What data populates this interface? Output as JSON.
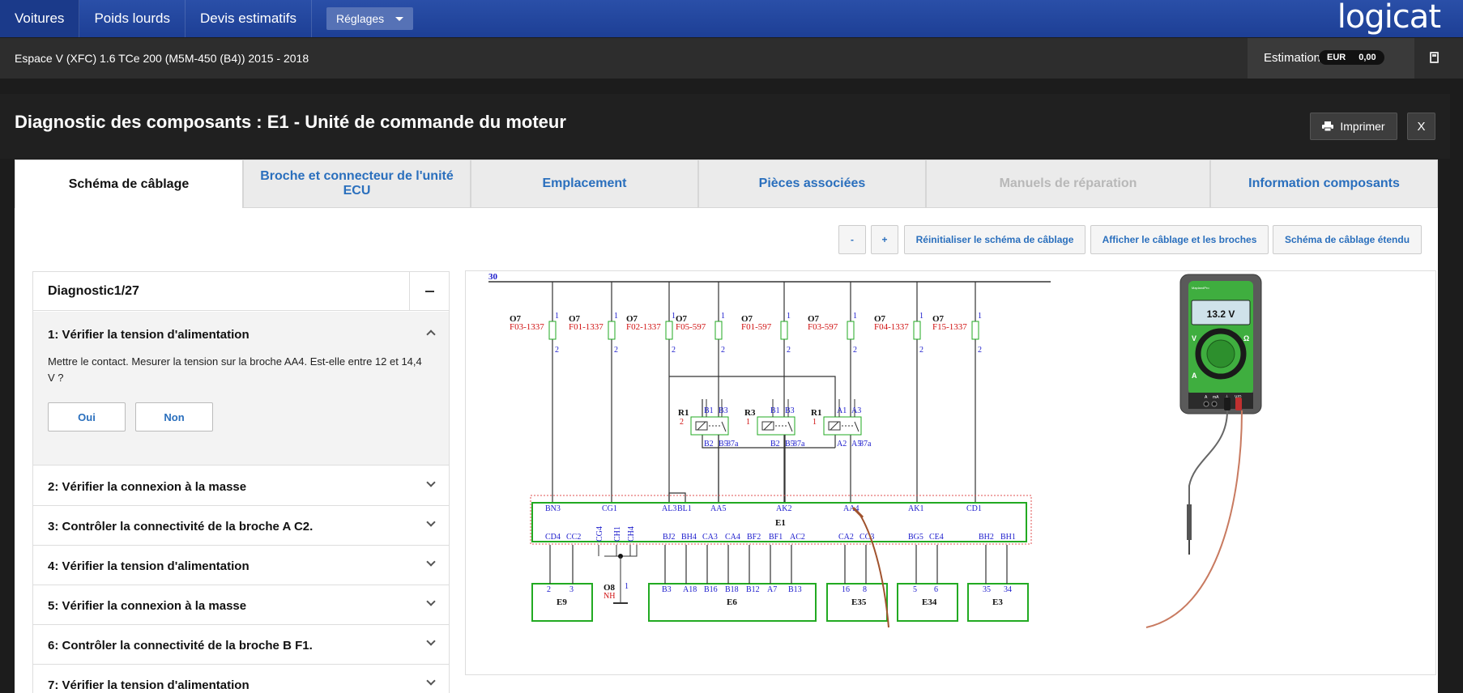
{
  "nav": {
    "items": [
      "Voitures",
      "Poids lourds",
      "Devis estimatifs"
    ],
    "settings": "Réglages",
    "logo": "logicat"
  },
  "vehicle": {
    "name": "Espace V (XFC) 1.6 TCe 200 (M5M-450 (B4)) 2015 - 2018",
    "estimation_label": "Estimation",
    "currency": "EUR",
    "amount": "0,00"
  },
  "modal": {
    "title": "Diagnostic des composants : E1 - Unité de commande du moteur",
    "print_label": "Imprimer",
    "close_label": "X"
  },
  "tabs": [
    {
      "label": "Schéma de câblage",
      "state": "active"
    },
    {
      "label": "Broche et connecteur de l'unité ECU",
      "state": "normal"
    },
    {
      "label": "Emplacement",
      "state": "normal"
    },
    {
      "label": "Pièces associées",
      "state": "normal"
    },
    {
      "label": "Manuels de réparation",
      "state": "disabled"
    },
    {
      "label": "Information composants",
      "state": "normal"
    }
  ],
  "toolbar": {
    "zoom_out": "-",
    "zoom_in": "+",
    "reset": "Réinitialiser le schéma de câblage",
    "show_pins": "Afficher le câblage et les broches",
    "extended": "Schéma de câblage étendu"
  },
  "diagnostic": {
    "title": "Diagnostic1/27",
    "open_step": {
      "title": "1: Vérifier la tension d'alimentation",
      "text": "Mettre le contact. Mesurer la tension sur la broche AA4. Est-elle entre 12 et 14,4 V ?",
      "yes": "Oui",
      "no": "Non"
    },
    "steps": [
      "2: Vérifier la connexion à la masse",
      "3: Contrôler la connectivité de la broche A C2.",
      "4: Vérifier la tension d'alimentation",
      "5: Vérifier la connexion à la masse",
      "6: Contrôler la connectivité de la broche B F1.",
      "7: Vérifier la tension d'alimentation"
    ]
  },
  "schema": {
    "bus_label": "30",
    "fuses": [
      {
        "code": "F03-1337"
      },
      {
        "code": "F01-1337"
      },
      {
        "code": "F02-1337"
      },
      {
        "code": "F05-597"
      },
      {
        "code": "F01-597"
      },
      {
        "code": "F03-597"
      },
      {
        "code": "F04-1337"
      },
      {
        "code": "F15-1337"
      }
    ],
    "fuse_group": "O7",
    "relays": [
      {
        "name": "R1",
        "num": "2",
        "top": [
          "B1",
          "B3"
        ],
        "bottom": [
          "B2",
          "B5",
          "87a"
        ]
      },
      {
        "name": "R3",
        "num": "1",
        "top": [
          "B1",
          "B3"
        ],
        "bottom": [
          "B2",
          "B5",
          "87a"
        ]
      },
      {
        "name": "R1",
        "num": "1",
        "top": [
          "A1",
          "A3"
        ],
        "bottom": [
          "A2",
          "A5",
          "87a"
        ]
      }
    ],
    "ecu_name": "E1",
    "ecu_top_pins": [
      "BN3",
      "CG1",
      "AL3",
      "BL1",
      "AA5",
      "AK2",
      "AA4",
      "AK1",
      "CD1"
    ],
    "ecu_bottom_pins": [
      "CD4",
      "CC2",
      "CG4",
      "CH1",
      "CH4",
      "BJ2",
      "BH4",
      "CA3",
      "CA4",
      "BF2",
      "BF1",
      "AC2",
      "CA2",
      "CC3",
      "BG5",
      "CE4",
      "BH2",
      "BH1"
    ],
    "connectors": [
      {
        "name": "E9",
        "pins": [
          "2",
          "3"
        ]
      },
      {
        "name": "E6",
        "pins": [
          "B3",
          "A18",
          "B16",
          "B18",
          "B12",
          "A7",
          "B13"
        ]
      },
      {
        "name": "E35",
        "pins": [
          "16",
          "8"
        ]
      },
      {
        "name": "E34",
        "pins": [
          "5",
          "6"
        ]
      },
      {
        "name": "E3",
        "pins": [
          "35",
          "34"
        ]
      }
    ],
    "ground": {
      "name": "O8",
      "sub": "NH",
      "pin": "1"
    },
    "multimeter": {
      "reading": "13.2 V",
      "brand": "MaplandPro",
      "ports": [
        "A",
        "mA",
        "⏚",
        "V/Ω"
      ],
      "dial": [
        "V",
        "Ω",
        "A"
      ]
    }
  }
}
